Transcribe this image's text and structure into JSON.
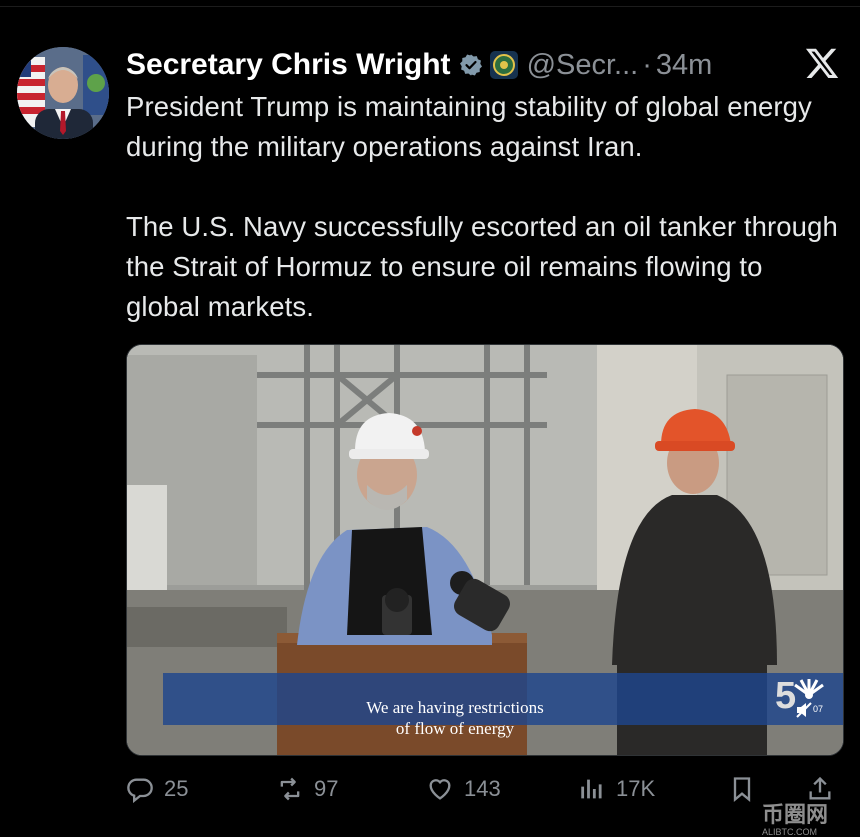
{
  "author": {
    "name": "Secretary Chris Wright",
    "handle": "@Secr...",
    "separator": "·",
    "time": "34m",
    "verified_color": "#829aab"
  },
  "tweet": {
    "paragraph1": "President Trump is maintaining stability of global energy during the military operations against Iran.",
    "paragraph2": "The U.S. Navy successfully escorted an oil tanker through the Strait of Hormuz to ensure oil remains flowing to global markets."
  },
  "video": {
    "caption_line1": "We are having restrictions",
    "caption_line2": "of flow of energy",
    "channel_badge": "5",
    "badge_timecode": "07"
  },
  "actions": {
    "replies": "25",
    "reposts": "97",
    "likes": "143",
    "views": "17K"
  },
  "watermark": {
    "text": "币圈网",
    "url": "ALIBTC.COM"
  }
}
